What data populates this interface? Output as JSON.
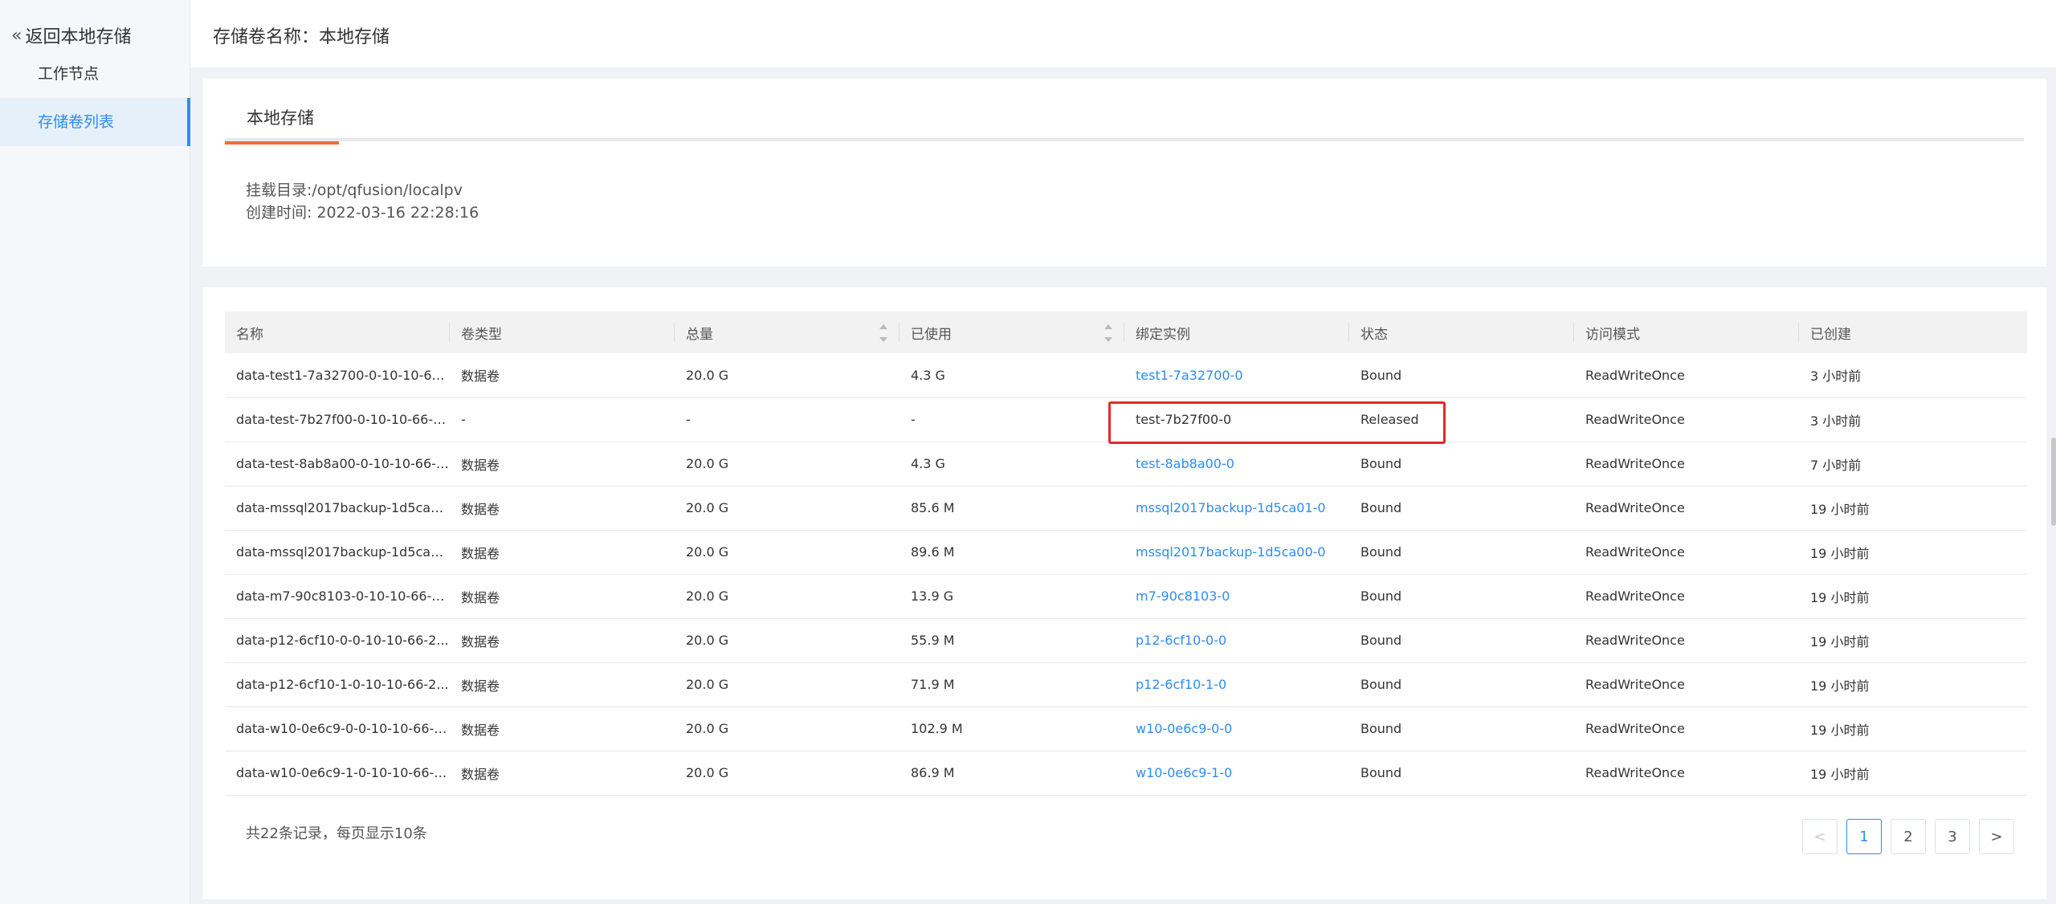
{
  "sidebar": {
    "back_label": "返回本地存储",
    "items": [
      {
        "label": "工作节点"
      },
      {
        "label": "存储卷列表"
      }
    ]
  },
  "header": {
    "title": "存储卷名称：本地存储"
  },
  "info": {
    "tab_label": "本地存储",
    "mount_dir": "挂载目录:/opt/qfusion/localpv",
    "created_time": "创建时间: 2022-03-16 22:28:16"
  },
  "table": {
    "columns": [
      "名称",
      "卷类型",
      "总量",
      "已使用",
      "绑定实例",
      "状态",
      "访问模式",
      "已创建"
    ],
    "rows": [
      {
        "name": "data-test1-7a32700-0-10-10-66-...",
        "type": "数据卷",
        "total": "20.0 G",
        "used": "4.3 G",
        "instance": "test1-7a32700-0",
        "status": "Bound",
        "access": "ReadWriteOnce",
        "created": "3 小时前"
      },
      {
        "name": "data-test-7b27f00-0-10-10-66-2...",
        "type": "-",
        "total": "-",
        "used": "-",
        "instance": "test-7b27f00-0",
        "status": "Released",
        "access": "ReadWriteOnce",
        "created": "3 小时前"
      },
      {
        "name": "data-test-8ab8a00-0-10-10-66-2...",
        "type": "数据卷",
        "total": "20.0 G",
        "used": "4.3 G",
        "instance": "test-8ab8a00-0",
        "status": "Bound",
        "access": "ReadWriteOnce",
        "created": "7 小时前"
      },
      {
        "name": "data-mssql2017backup-1d5ca0...",
        "type": "数据卷",
        "total": "20.0 G",
        "used": "85.6 M",
        "instance": "mssql2017backup-1d5ca01-0",
        "status": "Bound",
        "access": "ReadWriteOnce",
        "created": "19 小时前"
      },
      {
        "name": "data-mssql2017backup-1d5ca0...",
        "type": "数据卷",
        "total": "20.0 G",
        "used": "89.6 M",
        "instance": "mssql2017backup-1d5ca00-0",
        "status": "Bound",
        "access": "ReadWriteOnce",
        "created": "19 小时前"
      },
      {
        "name": "data-m7-90c8103-0-10-10-66-2...",
        "type": "数据卷",
        "total": "20.0 G",
        "used": "13.9 G",
        "instance": "m7-90c8103-0",
        "status": "Bound",
        "access": "ReadWriteOnce",
        "created": "19 小时前"
      },
      {
        "name": "data-p12-6cf10-0-0-10-10-66-2...",
        "type": "数据卷",
        "total": "20.0 G",
        "used": "55.9 M",
        "instance": "p12-6cf10-0-0",
        "status": "Bound",
        "access": "ReadWriteOnce",
        "created": "19 小时前"
      },
      {
        "name": "data-p12-6cf10-1-0-10-10-66-2...",
        "type": "数据卷",
        "total": "20.0 G",
        "used": "71.9 M",
        "instance": "p12-6cf10-1-0",
        "status": "Bound",
        "access": "ReadWriteOnce",
        "created": "19 小时前"
      },
      {
        "name": "data-w10-0e6c9-0-0-10-10-66-2...",
        "type": "数据卷",
        "total": "20.0 G",
        "used": "102.9 M",
        "instance": "w10-0e6c9-0-0",
        "status": "Bound",
        "access": "ReadWriteOnce",
        "created": "19 小时前"
      },
      {
        "name": "data-w10-0e6c9-1-0-10-10-66-2...",
        "type": "数据卷",
        "total": "20.0 G",
        "used": "86.9 M",
        "instance": "w10-0e6c9-1-0",
        "status": "Bound",
        "access": "ReadWriteOnce",
        "created": "19 小时前"
      }
    ]
  },
  "pagination": {
    "summary": "共22条记录，每页显示10条",
    "prev": "<",
    "pages": [
      "1",
      "2",
      "3"
    ],
    "current": "1",
    "next": ">"
  },
  "colors": {
    "accent": "#2d8cf0",
    "tab_underline": "#f26b3a",
    "highlight": "#e02a2a"
  }
}
